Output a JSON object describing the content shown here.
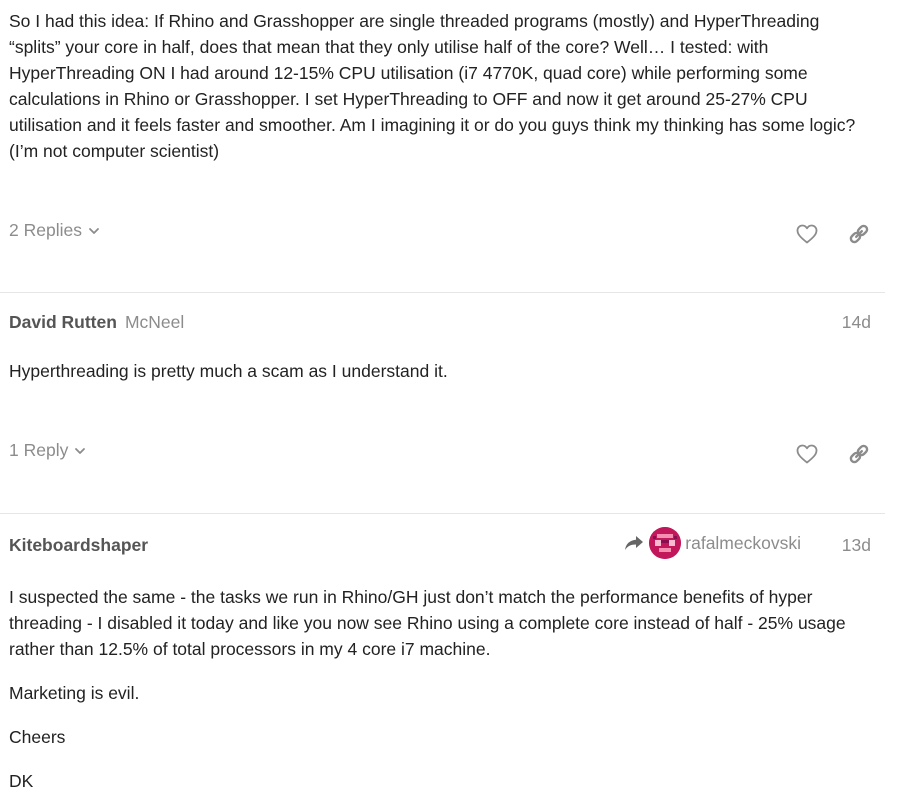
{
  "posts": [
    {
      "paragraphs": [
        "So I had this idea: If Rhino and Grasshopper are single threaded programs (mostly) and HyperThreading “splits” your core in half, does that mean that they only utilise half of the core? Well… I tested: with HyperThreading ON I had around 12-15% CPU utilisation (i7 4770K, quad core) while performing some calculations in Rhino or Grasshopper. I set HyperThreading to OFF and now it get around 25-27% CPU utilisation and it feels faster and smoother. Am I imagining it or do you guys think my thinking has some logic? (I’m not computer scientist)"
      ],
      "replies_label": "2 Replies"
    },
    {
      "username": "David Rutten",
      "user_title": "McNeel",
      "date": "14d",
      "paragraphs": [
        "Hyperthreading is pretty much a scam as I understand it."
      ],
      "replies_label": "1 Reply"
    },
    {
      "username": "Kiteboardshaper",
      "reply_to_user": "rafalmeckovski",
      "date": "13d",
      "paragraphs": [
        "I suspected the same - the tasks we run in Rhino/GH just don’t match the performance benefits of hyper threading - I disabled it today and like you now see Rhino using a complete core instead of half - 25% usage rather than 12.5% of total processors in my 4 core i7 machine.",
        "Marketing is evil.",
        "Cheers",
        "DK"
      ]
    }
  ],
  "icons": {
    "like": "heart-outline-icon",
    "share": "link-icon",
    "expand": "chevron-down-icon",
    "reply_to": "share-arrow-icon"
  },
  "colors": {
    "text": "#222222",
    "muted": "#8c8c8c",
    "username": "#555555",
    "divider": "#e6e6e6",
    "avatar": "#c2185b"
  }
}
